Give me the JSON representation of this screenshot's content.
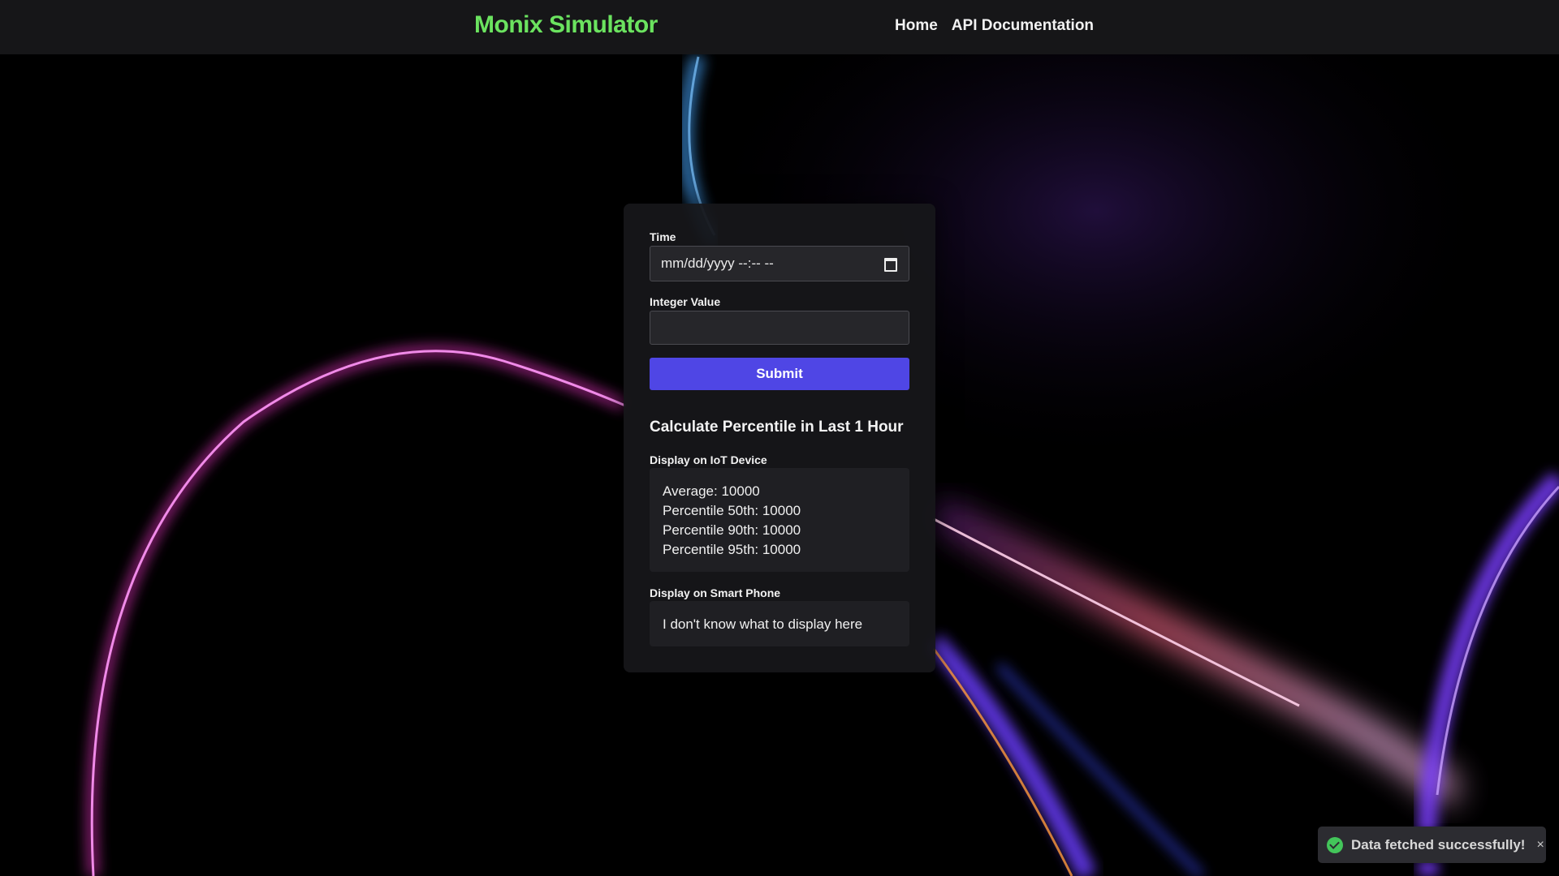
{
  "navbar": {
    "brand": "Monix Simulator",
    "links": [
      "Home",
      "API Documentation"
    ]
  },
  "form": {
    "time_label": "Time",
    "time_placeholder": "mm/dd/yyyy --:-- --",
    "integer_label": "Integer Value",
    "integer_value": "",
    "submit_label": "Submit"
  },
  "percentile": {
    "title": "Calculate Percentile in Last 1 Hour",
    "iot_label": "Display on IoT Device",
    "iot_lines": [
      "Average: 10000",
      "Percentile 50th: 10000",
      "Percentile 90th: 10000",
      "Percentile 95th: 10000"
    ],
    "phone_label": "Display on Smart Phone",
    "phone_text": "I don't know what to display here"
  },
  "toast": {
    "message": "Data fetched successfully!",
    "close": "×",
    "icon": "check-circle-icon"
  },
  "colors": {
    "brand": "#6be35f",
    "accent": "#4f46e5",
    "success": "#43c55a"
  }
}
